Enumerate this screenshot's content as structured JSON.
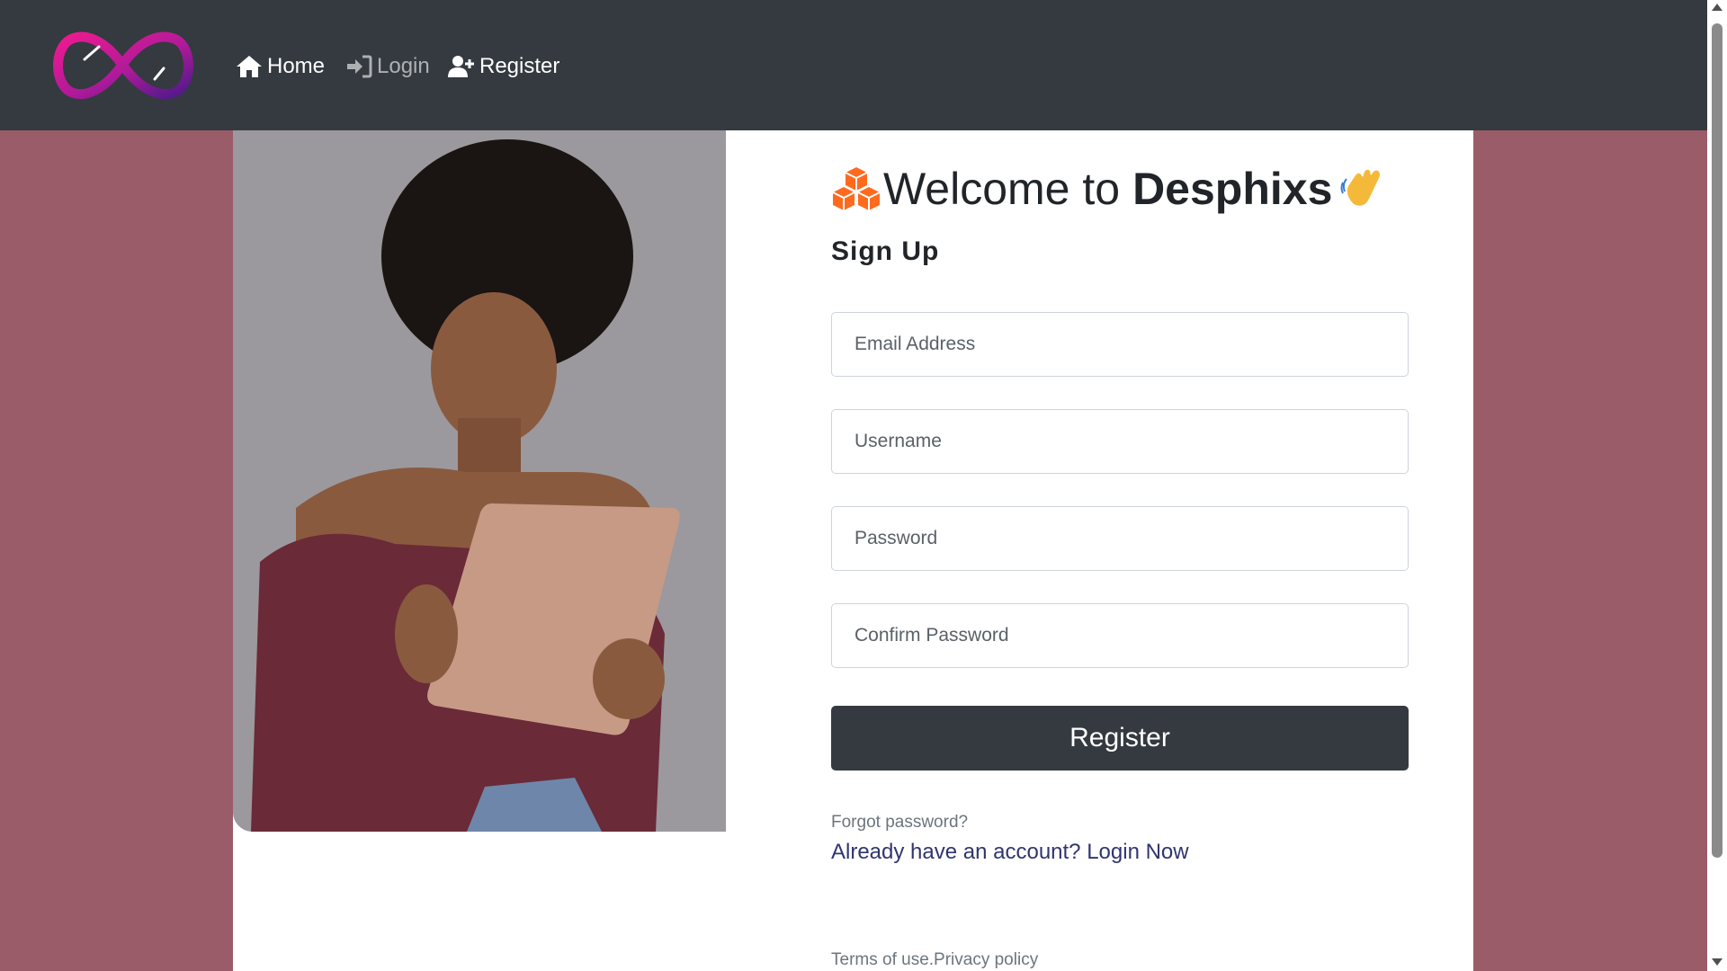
{
  "nav": {
    "logo_icon": "infinity-logo",
    "home": {
      "label": "Home",
      "icon": "home-icon"
    },
    "login": {
      "label": "Login",
      "icon": "sign-in-icon"
    },
    "register": {
      "label": "Register",
      "icon": "user-plus-icon"
    }
  },
  "hero": {
    "welcome_prefix": "Welcome to",
    "brand": "Desphixs",
    "subtitle": "Sign Up"
  },
  "form": {
    "email_placeholder": "Email Address",
    "username_placeholder": "Username",
    "password_placeholder": "Password",
    "confirm_placeholder": "Confirm Password",
    "submit_label": "Register"
  },
  "links": {
    "forgot": "Forgot password?",
    "login_prompt": "Already have an account? Login Now",
    "terms": "Terms of use.",
    "privacy": "Privacy policy"
  },
  "colors": {
    "navbar": "#343a40",
    "page_background": "#9b5c69",
    "button": "#343a40",
    "link": "#30356e"
  }
}
